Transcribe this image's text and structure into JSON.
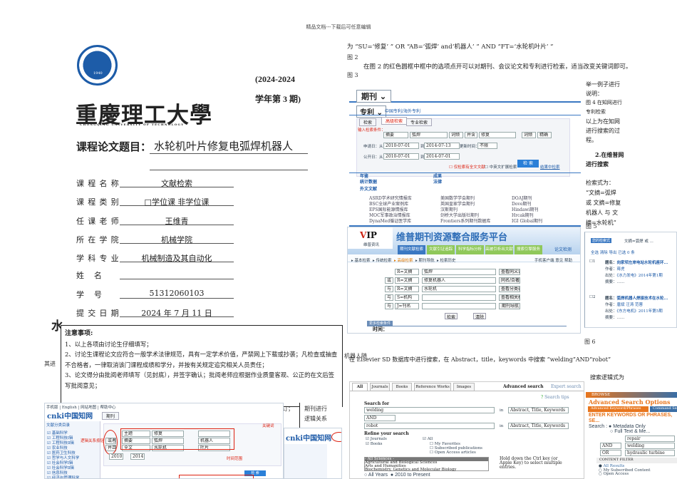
{
  "header_note": "精品文档---下载后可任意编辑",
  "cover": {
    "logo_text": "重庆理工大学 CHONGQING UNIVERSITY OF TECHNOLOGY 1940",
    "university_cn": "重慶理工大學",
    "university_en": "CHONGQING UNIVERSITY OF TECHNOLOGY",
    "term_line1": "(2024-2024",
    "term_line2": "学年第 3 期)",
    "title_label": "课程论文题目：",
    "title_value": "水轮机叶片修复电弧焊机器人",
    "fields": [
      {
        "label": "课程名称",
        "value": "文献检索"
      },
      {
        "label": "课程类别",
        "value": "□学位课      非学位课"
      },
      {
        "label": "任课老师",
        "value": "王维青"
      },
      {
        "label": "所在学院",
        "value": "机械学院"
      },
      {
        "label": "学科专业",
        "value": "机械制造及其自动化"
      },
      {
        "label": "姓    名",
        "value": ""
      },
      {
        "label": "学    号",
        "value": "51312060103"
      },
      {
        "label": "提交日期",
        "value": "2024 年 7 月 11 日"
      }
    ]
  },
  "notice": {
    "title": "注意事项:",
    "items": [
      "1、以上各项由讨论生仔细填写；",
      "2、讨论生课程论文应符合一般学术法律规范，具有一定学术价值，严禁网上下载或抄袭；凡检查或抽查不合格者，一律取消该门课程成绩和学分，并按有关规定追究相关人员责任；",
      "3、论文得分由批阅老师填写（见封底），并签字确认；批阅老师应根据作业质量客观、公正的在文后签写批阅意见；"
    ]
  },
  "behind": {
    "big_char": "水",
    "frag1": "其进",
    "frag2": "机器人随",
    "frag3": "订；",
    "frag4": "期刊进行",
    "frag5": "逻辑关系"
  },
  "right": {
    "line1": "为 “SU=‘修复’ ” OR “AB=‘弧焊’ and‘机器人’ ” AND “FT=‘水轮机叶片’ ”",
    "fig2": "图 2",
    "para": "在图 2 的红色圆框中框中的选项点开可以对期刊、会议论文和专利进行检索，适当改变关键词即可。",
    "fig3": "图 3",
    "side_lines": [
      "举一例子进行",
      "说明：",
      "图 4 在知网进行",
      "专利检索",
      "以上为在知网",
      "进行搜索的过",
      "程。"
    ],
    "section2": [
      "2.在维普网",
      "进行搜索"
    ],
    "expr_lines": [
      "检索式为：",
      "“文摘=弧焊",
      "或 文摘=修复",
      "机器人 与 文",
      "摘=水轮机”"
    ],
    "fig5": "图 5",
    "fig6": "图 6",
    "elsevier_para": "在 Elsevier SD 数据库中进行搜索，在 Abstract，title，keywords 中搜索 “welding”AND“robot”",
    "logic_label": "搜索逻辑式为"
  },
  "cnki_patent": {
    "db_tab": "期刊",
    "sub_tab": "专利",
    "sub_link": "中国专利/海外专利",
    "tabs": [
      "检索",
      "高级检索",
      "专业检索"
    ],
    "condition_label": "输入检索条件：",
    "field1": "摘要",
    "term1": "弧焊",
    "match1": "词频",
    "op": "并含",
    "term2": "修复",
    "match2": "词频",
    "mode": "精确",
    "apply_label": "申请日：从",
    "apply_from": "2010-07-01",
    "apply_to": "2014-07-13",
    "update_label": "更新时间：",
    "update_val": "不限",
    "pub_label": "公开日：从",
    "pub_from": "2010-07-01",
    "pub_to": "2014-07-01",
    "to": "到",
    "chk1": "仅检索有全文文献",
    "chk2": "中英文扩展检索",
    "search_btn": "检 索",
    "result_link": "结果中检索",
    "cats": [
      "年鉴",
      "统计数据",
      "成果",
      "法律"
    ],
    "foreign": "外文文献",
    "dbs": [
      "ASRD学术研究情报库",
      "美国数学学会期刊",
      "DOAJ期刊",
      "BSC全球产业案例库",
      "英国皇家学会期刊",
      "Dove期刊",
      "EPS国际能源情报库",
      "汉斯期刊",
      "Hindawi期刊",
      "MOC军事政治情报库",
      "剑桥大学出版社期刊",
      "Hrcak期刊",
      "DynaMed循证医学库",
      "Frontiers系列期刊数据库",
      "IGI Global期刊"
    ]
  },
  "vip": {
    "brand": "维普资讯",
    "title": "维普期刊资源整合服务平台",
    "nav": [
      "期刊文献检索",
      "文献引证追踪",
      "科学指标分析",
      "高被引析出文献",
      "搜索引擎服务"
    ],
    "check": "论文检测",
    "subtabs": [
      "基本检索",
      "传统检索",
      "高级检索",
      "期刊导航",
      "检索历史"
    ],
    "tools": [
      "手机客户端",
      "意见",
      "帮助"
    ],
    "rows": [
      {
        "op": "",
        "field": "R=文摘",
        "term": "弧焊",
        "btn": "查看同义词"
      },
      {
        "op": "或",
        "field": "R=文摘",
        "term": "修复机器人",
        "btn": "同名/合著作者"
      },
      {
        "op": "与",
        "field": "R=文摘",
        "term": "水轮机",
        "btn": "查看分类表"
      },
      {
        "op": "与",
        "field": "S=机构",
        "term": "",
        "btn": "查看相关机构"
      },
      {
        "op": "与",
        "field": "J=刊名",
        "term": "",
        "btn": "期刊导航"
      }
    ],
    "search": "检索",
    "clear": "清除",
    "limit_tab": "更多检索条件",
    "time_label": "时间："
  },
  "vip_result": {
    "badge": "您的检索式",
    "expr": "文摘=弧焊 或 ...",
    "actions": "全选 清除 导出 已选 0 条",
    "items": [
      {
        "n": "1",
        "title_label": "题名：",
        "title": "向家坝左岸电站水轮机座环...",
        "author": "蒋虎",
        "source": "《水力发电》2014年第1期"
      },
      {
        "n": "2",
        "title_label": "题名：",
        "title": "弧焊机器人焊接技术在水轮...",
        "author": "唐斌 汪涛 范蓉",
        "source": "《东方电机》2011年第5期"
      }
    ],
    "author_label": "作者：",
    "source_label": "出处：",
    "abstract_label": "摘要："
  },
  "elsevier": {
    "tabs": [
      "All",
      "Journals",
      "Books",
      "Reference Works",
      "Images"
    ],
    "adv": "Advanced search",
    "expert": "Expert search",
    "tips": "Search tips",
    "search_for": "Search for",
    "term1": "welding",
    "in": "in",
    "field": "Abstract, Title, Keywords",
    "op": "AND",
    "term2": "robot",
    "refine": "Refine your search",
    "checks_left": [
      "Journals",
      "Books"
    ],
    "checks_right": [
      "All",
      "My Favorites",
      "Subscribed publications",
      "Open Access articles"
    ],
    "subjects": [
      "- All Sciences -",
      "Agricultural and Biological Sciences",
      "Arts and Humanities",
      "Biochemistry, Genetics and Molecular Biology"
    ],
    "hint": "Hold down the Ctrl key (or Apple Key) to select multiple entries.",
    "years_all": "All Years",
    "year_from": "2010",
    "to": "to",
    "year_to": "Present"
  },
  "ieee": {
    "browse": "BROWSE",
    "title": "Advanced Search Options",
    "tab1": "Advanced Keyword/Phrases",
    "tab2": "Command Search",
    "enter": "ENTER KEYWORDS OR PHRASES, SE...",
    "search_label": "Search :",
    "opt1": "Metadata Only",
    "opt2": "Full Text & Me...",
    "rows": [
      {
        "op": "",
        "term": "repair"
      },
      {
        "op": "AND",
        "term": "welding"
      },
      {
        "op": "OR",
        "term": "hydraulic turbine"
      }
    ],
    "filter": "CONTENT FILTER",
    "filters": [
      "All Results",
      "My Subscribed Content",
      "Open Access"
    ]
  },
  "cnki_main": {
    "top_links": "手机版 | English | 网站地图 | 帮助中心",
    "db": "期刊",
    "annot1": "逻辑关系按钮",
    "annot2": "关键词",
    "annot3": "时间范围",
    "side_title": "文献分类目录",
    "side_items": [
      "基础科学",
      "工程科技Ⅰ辑",
      "工程科技Ⅱ辑",
      "农业科技",
      "医药卫生科技",
      "哲学与人文科学",
      "社会科学Ⅰ辑",
      "社会科学Ⅱ辑",
      "信息科技",
      "经济与管理科学"
    ],
    "rows": [
      {
        "op": "",
        "f": "主题",
        "t": "修复"
      },
      {
        "op": "或者",
        "f": "摘要",
        "t": "弧焊",
        "t2": "机器人"
      },
      {
        "op": "并且",
        "f": "全文",
        "t": "水轮机",
        "t2": "叶片"
      }
    ],
    "year_from": "2010",
    "year_to": "2014",
    "search": "检 索"
  },
  "colors": {
    "cnki_blue": "#1e5ba8",
    "red": "#d21f1f",
    "vip_green": "#7cc24a",
    "ieee_orange": "#e8761e"
  }
}
